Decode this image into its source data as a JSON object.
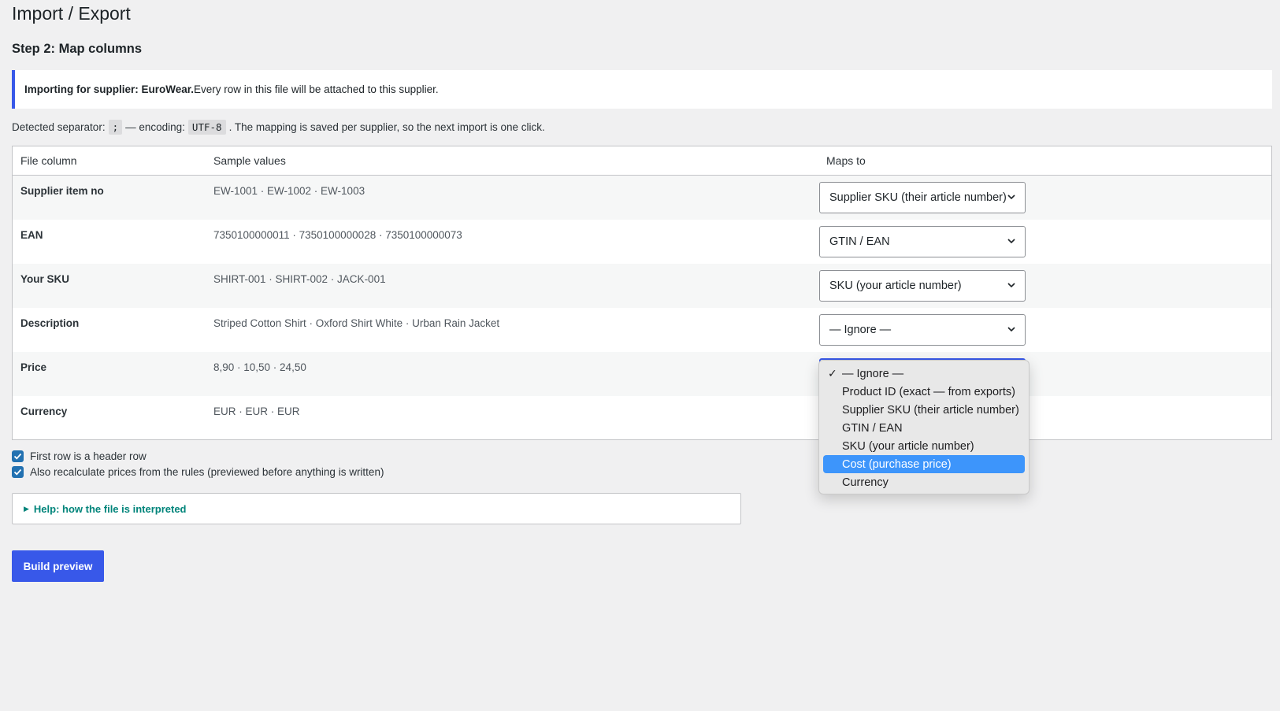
{
  "page": {
    "title": "Import / Export",
    "step_title": "Step 2: Map columns"
  },
  "notice": {
    "bold": "Importing for supplier: EuroWear.",
    "rest": " Every row in this file will be attached to this supplier."
  },
  "detection": {
    "prefix": "Detected separator:",
    "separator": ";",
    "middle": "— encoding:",
    "encoding": "UTF-8",
    "suffix": ". The mapping is saved per supplier, so the next import is one click."
  },
  "table": {
    "headers": {
      "file": "File column",
      "sample": "Sample values",
      "maps": "Maps to"
    },
    "rows": [
      {
        "file": "Supplier item no",
        "sample": "EW-1001 · EW-1002 · EW-1003",
        "maps": "Supplier SKU (their article number)"
      },
      {
        "file": "EAN",
        "sample": "7350100000011 · 7350100000028 · 7350100000073",
        "maps": "GTIN / EAN"
      },
      {
        "file": "Your SKU",
        "sample": "SHIRT-001 · SHIRT-002 · JACK-001",
        "maps": "SKU (your article number)"
      },
      {
        "file": "Description",
        "sample": "Striped Cotton Shirt · Oxford Shirt White · Urban Rain Jacket",
        "maps": "— Ignore —"
      },
      {
        "file": "Price",
        "sample": "8,90 · 10,50 · 24,50",
        "maps": ""
      },
      {
        "file": "Currency",
        "sample": "EUR · EUR · EUR",
        "maps": ""
      }
    ]
  },
  "dropdown": {
    "options": [
      "— Ignore —",
      "Product ID (exact — from exports)",
      "Supplier SKU (their article number)",
      "GTIN / EAN",
      "SKU (your article number)",
      "Cost (purchase price)",
      "Currency"
    ],
    "checked_index": 0,
    "highlighted_index": 5
  },
  "options": {
    "header_row": {
      "label": "First row is a header row",
      "checked": true
    },
    "recalc": {
      "label": "Also recalculate prices from the rules (previewed before anything is written)",
      "checked": true
    }
  },
  "help": {
    "label": "Help: how the file is interpreted"
  },
  "actions": {
    "build_preview": "Build preview"
  },
  "colors": {
    "accent": "#3858e9",
    "help_link": "#00847a",
    "highlight": "#3d95fb"
  }
}
